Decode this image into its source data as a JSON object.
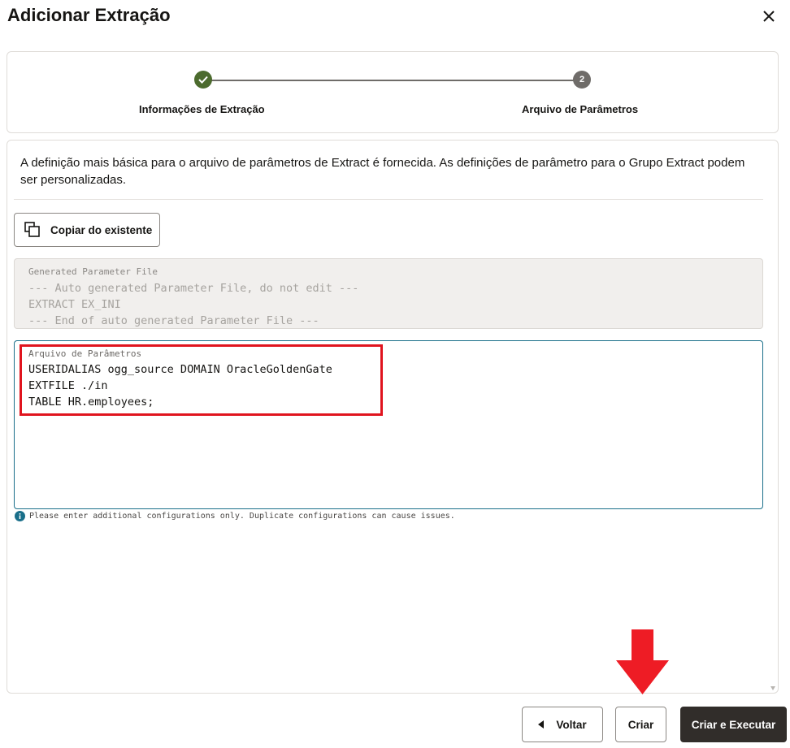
{
  "dialog": {
    "title": "Adicionar Extração",
    "close_icon": "close-icon"
  },
  "stepper": {
    "steps": [
      {
        "number": "1",
        "label": "Informações de Extração",
        "status": "complete",
        "icon": "check-icon"
      },
      {
        "number": "2",
        "label": "Arquivo de Parâmetros",
        "status": "current"
      }
    ],
    "colors": {
      "complete": "#4c6b2e",
      "current": "#6f6c69"
    }
  },
  "content": {
    "description": "A definição mais básica para o arquivo de parâmetros de Extract é fornecida. As definições de parâmetro para o Grupo Extract podem ser personalizadas.",
    "copy_button": {
      "label": "Copiar do existente",
      "icon": "copy-icon"
    },
    "generated_file": {
      "label": "Generated Parameter File",
      "lines": [
        "--- Auto generated Parameter File, do not edit ---",
        "EXTRACT EX_INI",
        "--- End of auto generated Parameter File ---"
      ]
    },
    "param_file": {
      "label": "Arquivo de Parâmetros",
      "lines": [
        "USERIDALIAS ogg_source DOMAIN OracleGoldenGate",
        "EXTFILE ./in",
        "TABLE HR.employees;"
      ]
    },
    "info_message": "Please enter additional configurations only. Duplicate configurations can cause issues."
  },
  "footer": {
    "back_label": "Voltar",
    "create_label": "Criar",
    "create_run_label": "Criar e Executar"
  },
  "annotations": {
    "highlight_color": "#e0141e",
    "arrow_color": "#ee1c25"
  }
}
